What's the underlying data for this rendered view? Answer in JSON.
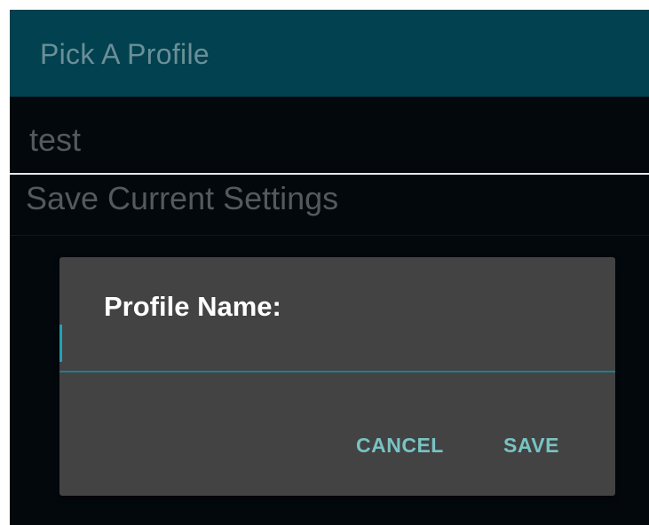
{
  "app_bar": {
    "title": "Pick A Profile"
  },
  "profiles": {
    "items": [
      {
        "label": "test"
      },
      {
        "label": "Save Current Settings"
      }
    ]
  },
  "dialog": {
    "title": "Profile Name:",
    "input": {
      "value": "",
      "placeholder": ""
    },
    "cancel_label": "CANCEL",
    "save_label": "SAVE"
  },
  "colors": {
    "app_bar": "#02414f",
    "background": "#03080d",
    "dialog": "#434343",
    "accent": "#1d7f8e",
    "button_text": "#79c3c3"
  }
}
